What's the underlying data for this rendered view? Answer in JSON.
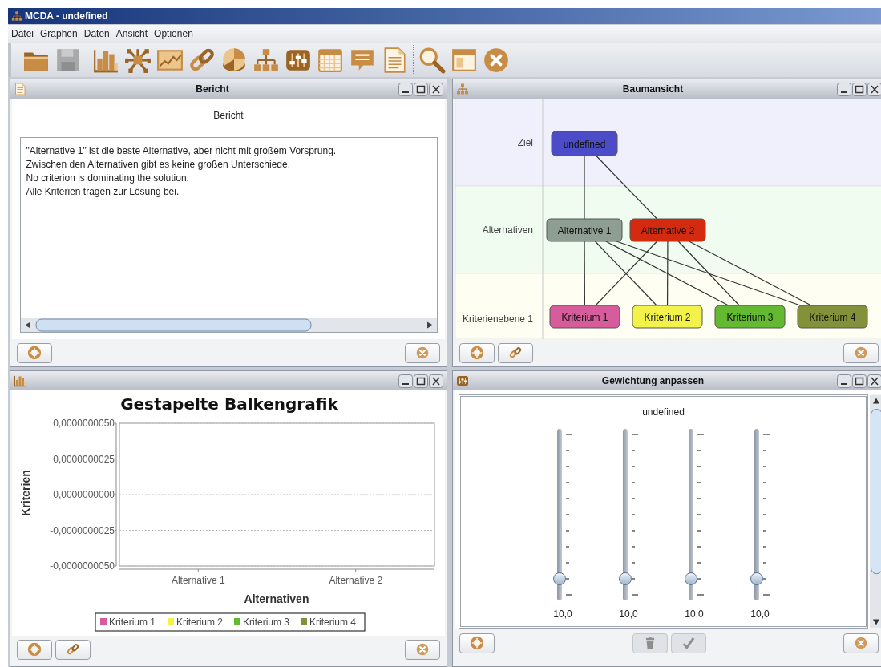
{
  "window": {
    "title": "MCDA - undefined"
  },
  "menu": [
    "Datei",
    "Graphen",
    "Daten",
    "Ansicht",
    "Optionen"
  ],
  "toolbar_groups": [
    [
      {
        "kind": "folder",
        "disabled": false
      },
      {
        "kind": "save",
        "disabled": true
      }
    ],
    [
      {
        "kind": "bar",
        "disabled": false
      },
      {
        "kind": "network",
        "disabled": false
      },
      {
        "kind": "linechart",
        "disabled": false
      },
      {
        "kind": "link",
        "disabled": false
      },
      {
        "kind": "pie",
        "disabled": false
      },
      {
        "kind": "hierarchy",
        "disabled": false
      },
      {
        "kind": "sliders",
        "disabled": false
      },
      {
        "kind": "calendar",
        "disabled": false
      },
      {
        "kind": "speech",
        "disabled": false
      },
      {
        "kind": "document",
        "disabled": false
      }
    ],
    [
      {
        "kind": "search",
        "disabled": false
      },
      {
        "kind": "layout",
        "disabled": false
      },
      {
        "kind": "close",
        "disabled": false
      }
    ]
  ],
  "report": {
    "title": "Bericht",
    "heading": "Bericht",
    "lines": [
      "\"Alternative 1\" ist die beste Alternative, aber nicht mit großem Vorsprung.",
      "Zwischen den Alternativen gibt es keine großen Unterschiede.",
      "No criterion is dominating the solution.",
      "Alle Kriterien tragen zur Lösung bei."
    ],
    "buttons": {
      "left": [
        {
          "kind": "help",
          "disabled": false
        }
      ],
      "right": [
        {
          "kind": "close",
          "disabled": false
        }
      ]
    }
  },
  "tree": {
    "title": "Baumansicht",
    "levels": [
      {
        "label": "Ziel",
        "color": "#f0f0fc",
        "nodes": [
          {
            "label": "undefined",
            "color": "#4c4cc8"
          }
        ]
      },
      {
        "label": "Alternativen",
        "color": "#effcef",
        "nodes": [
          {
            "label": "Alternative 1",
            "color": "#8f9e92"
          },
          {
            "label": "Alternative 2",
            "color": "#d42a10"
          }
        ]
      },
      {
        "label": "Kriterienebene 1",
        "color": "#fefef2",
        "nodes": [
          {
            "label": "Kriterium 1",
            "color": "#d75c9c"
          },
          {
            "label": "Kriterium 2",
            "color": "#f2f24a"
          },
          {
            "label": "Kriterium 3",
            "color": "#63b92f"
          },
          {
            "label": "Kriterium 4",
            "color": "#83923a"
          }
        ]
      }
    ],
    "buttons": {
      "left": [
        {
          "kind": "help",
          "disabled": false
        },
        {
          "kind": "link",
          "disabled": false
        }
      ],
      "right": [
        {
          "kind": "close",
          "disabled": false
        }
      ]
    }
  },
  "chart": {
    "chart_data": {
      "type": "bar",
      "grid": true,
      "title": "Gestapelte Balkengrafik",
      "xlabel": "Alternativen",
      "ylabel": "Kriterien",
      "categories": [
        "Alternative 1",
        "Alternative 2"
      ],
      "series": [
        {
          "name": "Kriterium 1",
          "color": "#d75c9c",
          "values": [
            null,
            null
          ]
        },
        {
          "name": "Kriterium 2",
          "color": "#f2f24a",
          "values": [
            null,
            null
          ]
        },
        {
          "name": "Kriterium 3",
          "color": "#63b92f",
          "values": [
            null,
            null
          ]
        },
        {
          "name": "Kriterium 4",
          "color": "#83923a",
          "values": [
            null,
            null
          ]
        }
      ],
      "ylim": [
        -5e-09,
        5e-09
      ],
      "yticks": [
        {
          "value": 5e-09,
          "label": "0,0000000050"
        },
        {
          "value": 2.5e-09,
          "label": "0,0000000025"
        },
        {
          "value": 0,
          "label": "0,0000000000"
        },
        {
          "value": -2.5e-09,
          "label": "-0,0000000025"
        },
        {
          "value": -5e-09,
          "label": "-0,0000000050"
        }
      ]
    },
    "buttons": {
      "left": [
        {
          "kind": "help",
          "disabled": false
        },
        {
          "kind": "link",
          "disabled": false
        }
      ],
      "right": [
        {
          "kind": "close",
          "disabled": false
        }
      ]
    }
  },
  "weights": {
    "title": "Gewichtung anpassen",
    "heading": "undefined",
    "sliders": [
      {
        "level": 0.1,
        "reading": "10,0"
      },
      {
        "level": 0.1,
        "reading": "10,0"
      },
      {
        "level": 0.1,
        "reading": "10,0"
      },
      {
        "level": 0.1,
        "reading": "10,0"
      }
    ],
    "buttons": {
      "left": [
        {
          "kind": "help",
          "disabled": false
        }
      ],
      "center": [
        {
          "kind": "delete",
          "disabled": true
        },
        {
          "kind": "apply",
          "disabled": true
        }
      ],
      "right": [
        {
          "kind": "close",
          "disabled": false
        }
      ]
    }
  }
}
